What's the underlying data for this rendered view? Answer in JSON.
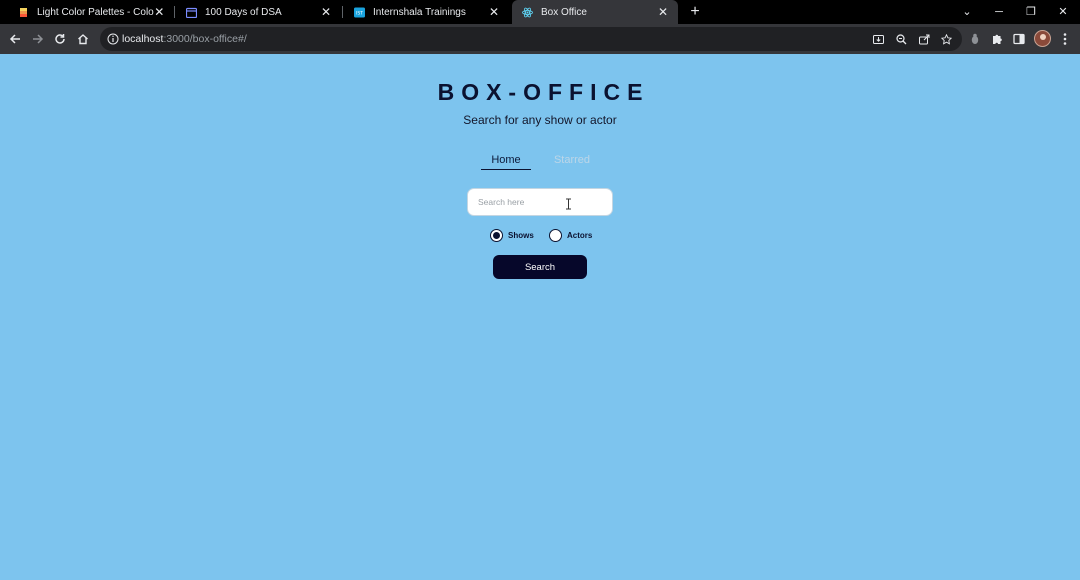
{
  "browser": {
    "tabs": [
      {
        "title": "Light Color Palettes - Color Hunt",
        "favicon": "color-hunt-icon",
        "active": false
      },
      {
        "title": "100 Days of DSA",
        "favicon": "calendar-icon",
        "active": false
      },
      {
        "title": "Internshala Trainings",
        "favicon": "internshala-icon",
        "active": false
      },
      {
        "title": "Box Office",
        "favicon": "react-icon",
        "active": true
      }
    ],
    "url_host": "localhost",
    "url_rest": ":3000/box-office#/",
    "colors": {
      "titlebar": "#000000",
      "toolbar": "#35363a",
      "omnibox": "#202124"
    }
  },
  "app": {
    "title": "BOX-OFFICE",
    "subtitle": "Search for any show or actor",
    "nav": {
      "home": "Home",
      "starred": "Starred"
    },
    "search": {
      "placeholder": "Search here",
      "value": ""
    },
    "radios": {
      "shows": "Shows",
      "actors": "Actors",
      "selected": "shows"
    },
    "search_button": "Search",
    "colors": {
      "background": "#7dc4ee",
      "primary": "#06072a",
      "text": "#0b1230"
    }
  }
}
